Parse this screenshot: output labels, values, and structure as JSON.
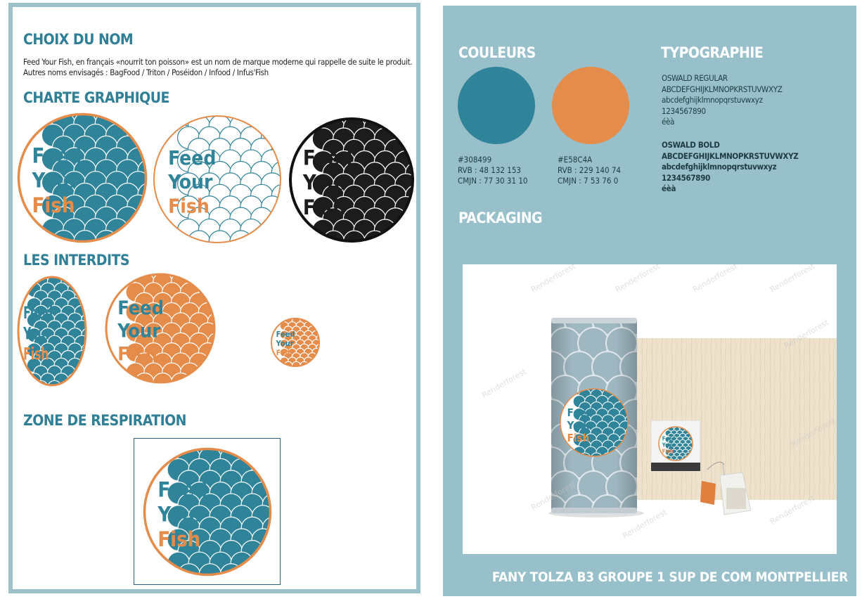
{
  "left": {
    "choix": {
      "title": "CHOIX DU NOM",
      "line1": "Feed Your Fish, en français «nourrit ton poisson» est un nom de marque moderne qui rappelle de suite le produit.",
      "line2": "Autres noms envisagés : BagFood / Triton / Poséidon / Infood / Infus'Fish"
    },
    "charte_title": "CHARTE GRAPHIQUE",
    "interdits_title": "LES INTERDITS",
    "zone_title": "ZONE DE RESPIRATION",
    "logo": {
      "w1": "Feed",
      "w2": "Your",
      "w3": "Fish"
    }
  },
  "right": {
    "couleurs_title": "COULEURS",
    "typo_title": "TYPOGRAPHIE",
    "packaging_title": "PACKAGING",
    "colors": [
      {
        "hex": "#308499",
        "code": "#308499",
        "rvb": "RVB : 48 132 153",
        "cmjn": "CMJN : 77 30 31 10"
      },
      {
        "hex": "#E58C4A",
        "code": "#E58C4A",
        "rvb": "RVB : 229 140 74",
        "cmjn": "CMJN : 7 53 76 0"
      }
    ],
    "typo_regular": {
      "name": "OSWALD REGULAR",
      "upper": "ABCDEFGHIJKLMNOPKRSTUVWXYZ",
      "lower": "abcdefghijklmnopqrstuvwxyz",
      "digits": "1234567890",
      "accents": "éèà"
    },
    "typo_bold": {
      "name": "OSWALD BOLD",
      "upper": "ABCDEFGHIJKLMNOPKRSTUVWXYZ",
      "lower": "abcdefghijklmnopqrstuvwxyz",
      "digits": "1234567890",
      "accents": "éèà"
    },
    "watermark": "Renderforest",
    "footer": "FANY TOLZA B3 GROUPE 1 SUP DE COM MONTPELLIER"
  },
  "brand_colors": {
    "teal": "#308499",
    "orange": "#E58C4A",
    "panel": "#98C0CA",
    "dark": "#222222"
  }
}
